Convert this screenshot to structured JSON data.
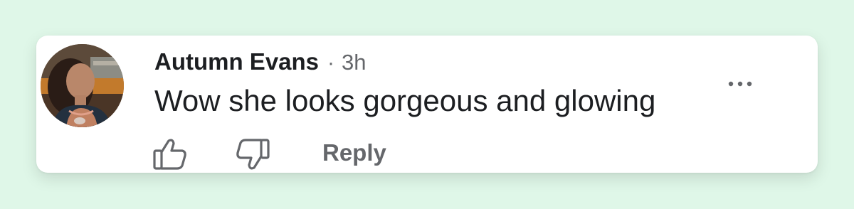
{
  "comment": {
    "author": "Autumn Evans",
    "separator": "·",
    "timestamp": "3h",
    "text": "Wow she looks gorgeous and glowing"
  },
  "actions": {
    "like_icon": "thumbs-up-outline",
    "dislike_icon": "thumbs-down-outline",
    "reply_label": "Reply",
    "more_icon": "horizontal-ellipsis"
  },
  "colors": {
    "page_background": "#dff7e8",
    "card_background": "#ffffff",
    "primary_text": "#1c1e21",
    "secondary_text": "#65676b"
  }
}
